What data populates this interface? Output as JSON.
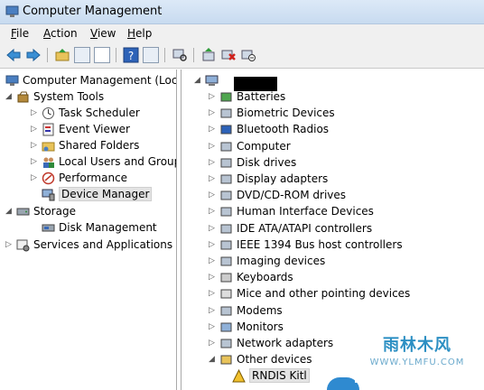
{
  "window": {
    "title": "Computer Management"
  },
  "menu": [
    "File",
    "Action",
    "View",
    "Help"
  ],
  "toolbar": {
    "icons": [
      "back-arrow-icon",
      "forward-arrow-icon",
      "up-folder-icon",
      "console-tree-icon",
      "export-icon",
      "help-icon",
      "properties-icon",
      "scan-hardware-icon",
      "update-driver-icon",
      "uninstall-icon",
      "disable-icon"
    ]
  },
  "left_tree": {
    "root": "Computer Management (Local",
    "system_tools": "System Tools",
    "task_scheduler": "Task Scheduler",
    "event_viewer": "Event Viewer",
    "shared_folders": "Shared Folders",
    "local_users": "Local Users and Groups",
    "performance": "Performance",
    "device_manager": "Device Manager",
    "storage": "Storage",
    "disk_management": "Disk Management",
    "services": "Services and Applications"
  },
  "devices": {
    "batteries": "Batteries",
    "biometric": "Biometric Devices",
    "bluetooth": "Bluetooth Radios",
    "computer": "Computer",
    "disk_drives": "Disk drives",
    "display": "Display adapters",
    "dvd": "DVD/CD-ROM drives",
    "hid": "Human Interface Devices",
    "ide": "IDE ATA/ATAPI controllers",
    "ieee": "IEEE 1394 Bus host controllers",
    "imaging": "Imaging devices",
    "keyboards": "Keyboards",
    "mice": "Mice and other pointing devices",
    "modems": "Modems",
    "monitors": "Monitors",
    "network": "Network adapters",
    "other": "Other devices",
    "rndis": "RNDIS Kitl"
  },
  "watermark": {
    "title": "雨林木风",
    "url": "WWW.YLMFU.COM"
  }
}
